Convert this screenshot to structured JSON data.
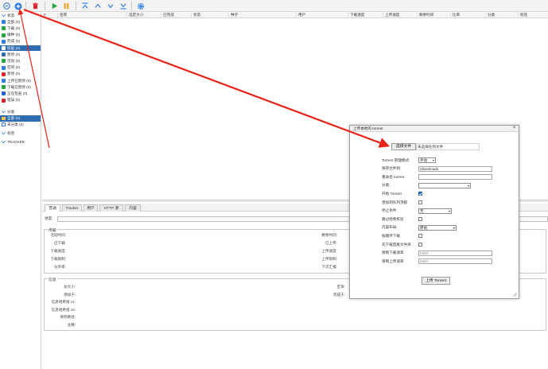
{
  "sidebar": {
    "status_header": "状态",
    "status_items": [
      {
        "label": "全部 (0)",
        "icon": "all-icon"
      },
      {
        "label": "下载 (0)",
        "icon": "download-icon"
      },
      {
        "label": "做种 (0)",
        "icon": "seeding-icon"
      },
      {
        "label": "完成 (0)",
        "icon": "completed-icon"
      },
      {
        "label": "恢复 (0)",
        "icon": "resumed-icon",
        "selected": true
      },
      {
        "label": "暂停 (0)",
        "icon": "paused-icon"
      },
      {
        "label": "活动 (0)",
        "icon": "active-icon"
      },
      {
        "label": "空闲 (0)",
        "icon": "inactive-icon"
      },
      {
        "label": "暂停 (0)",
        "icon": "stalled-icon"
      },
      {
        "label": "上传已暂停 (0)",
        "icon": "stalled-upload-icon"
      },
      {
        "label": "下载已暂停 (0)",
        "icon": "stalled-download-icon"
      },
      {
        "label": "正在检查 (0)",
        "icon": "checking-icon"
      },
      {
        "label": "错误 (0)",
        "icon": "error-icon"
      }
    ],
    "category_header": "分类",
    "category_items": [
      {
        "label": "全部 (0)",
        "selected": true
      },
      {
        "label": "未分类 (0)"
      }
    ],
    "tags_header": "标签",
    "trackers_header": "TRACKER"
  },
  "table": {
    "columns": [
      "#",
      "名称",
      "选定大小",
      "已完成",
      "状态",
      "种子",
      "用户",
      "下载速度",
      "上传速度",
      "剩余时间",
      "比率",
      "分类",
      "标签",
      "添加于"
    ]
  },
  "tabs": [
    "普通",
    "Tracker",
    "用户",
    "HTTP 源",
    "内容"
  ],
  "detail": {
    "progress_label": "进度:",
    "transfer_legend": "传输",
    "transfer_left": [
      "活动时间:",
      "已下载:",
      "下载速度:",
      "下载限制:",
      "分享率:"
    ],
    "transfer_right": [
      "剩余时间:",
      "已上传:",
      "上传速度:",
      "上传限制:",
      "下次汇报:"
    ],
    "info_legend": "信息",
    "info_left": [
      "总大小:",
      "添加于:",
      "信息哈希值 v1:",
      "信息哈希值 v2:",
      "保存路径:",
      "注释:"
    ],
    "info_right": [
      "区块:",
      "完成于:"
    ]
  },
  "dialog": {
    "title": "上传本地的 torrent",
    "choose_file_button": "选择文件",
    "no_file_text": "未选择任何文件",
    "rows": [
      {
        "label": "Torrent 管理模式:",
        "type": "select",
        "value": "手动"
      },
      {
        "label": "保存文件到:",
        "type": "input",
        "value": "/downloads"
      },
      {
        "label": "重命名 torrent",
        "type": "input",
        "value": ""
      },
      {
        "label": "分类:",
        "type": "select",
        "value": ""
      },
      {
        "label": "开始 Torrent",
        "type": "checkbox",
        "checked": true
      },
      {
        "label": "添加到队列顶部",
        "type": "checkbox",
        "checked": false
      },
      {
        "label": "停止条件:",
        "type": "select",
        "value": "无"
      },
      {
        "label": "跳过哈希校验",
        "type": "checkbox",
        "checked": false
      },
      {
        "label": "内容布局:",
        "type": "select",
        "value": "原始"
      },
      {
        "label": "按顺序下载",
        "type": "checkbox",
        "checked": false
      },
      {
        "label": "先下载首尾文件块",
        "type": "checkbox",
        "checked": false
      },
      {
        "label": "限制下载速率",
        "type": "input",
        "placeholder": "KiB/s"
      },
      {
        "label": "限制上传速率",
        "type": "input",
        "placeholder": "KiB/s"
      }
    ],
    "upload_button": "上传 Torrent"
  },
  "colors": {
    "selection": "#2f6db3",
    "annotation_arrow": "#e8231a",
    "toolbar_blue": "#2f7de0",
    "play_green": "#22a83a",
    "pause_orange": "#f3a21b",
    "delete_red": "#d9262b"
  }
}
